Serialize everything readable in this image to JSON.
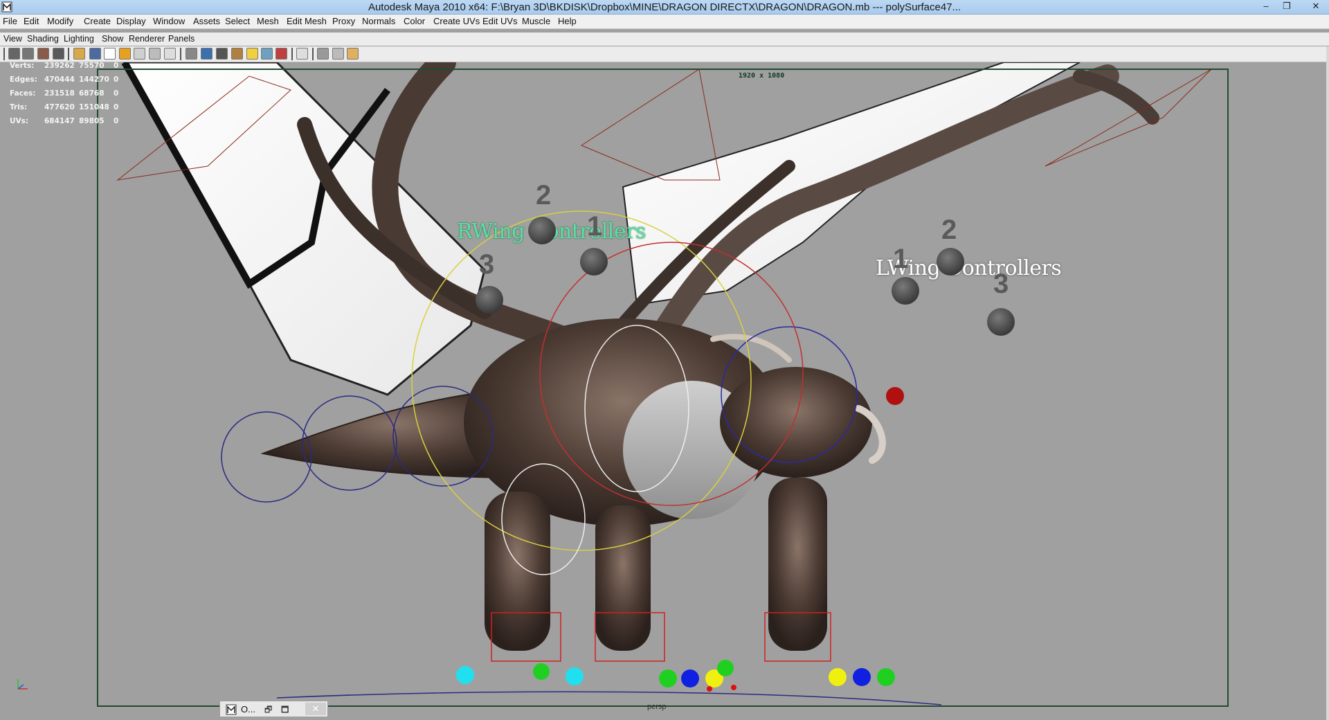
{
  "window": {
    "title": "Autodesk Maya 2010 x64: F:\\Bryan 3D\\BKDISK\\Dropbox\\MINE\\DRAGON DIRECTX\\DRAGON\\DRAGON.mb   ---   polySurface47...",
    "minimize": "–",
    "maximize": "❐",
    "close": "✕"
  },
  "menubar": [
    "File",
    "Edit",
    "Modify",
    "Create",
    "Display",
    "Window",
    "Assets",
    "Select",
    "Mesh",
    "Edit Mesh",
    "Proxy",
    "Normals",
    "Color",
    "Create UVs",
    "Edit UVs",
    "Muscle",
    "Help"
  ],
  "panel_menu": [
    "View",
    "Shading",
    "Lighting",
    "Show",
    "Renderer",
    "Panels"
  ],
  "hud": {
    "rows": [
      {
        "label": "Verts:",
        "a": "239262",
        "b": "75570",
        "c": "0"
      },
      {
        "label": "Edges:",
        "a": "470444",
        "b": "144270",
        "c": "0"
      },
      {
        "label": "Faces:",
        "a": "231518",
        "b": "68768",
        "c": "0"
      },
      {
        "label": "Tris:",
        "a": "477620",
        "b": "151048",
        "c": "0"
      },
      {
        "label": "UVs:",
        "a": "684147",
        "b": "89805",
        "c": "0"
      }
    ]
  },
  "viewport": {
    "resolution": "1920 x 1080",
    "camera": "persp",
    "rwing_label": "RWing Controllers",
    "lwing_label": "LWing Controllers",
    "numbers": [
      "2",
      "1",
      "3",
      "2",
      "1",
      "3"
    ]
  },
  "minimized_panel": {
    "label": "O...",
    "restore": "🗗",
    "maximize": "🗖",
    "close": "✕"
  },
  "colors": {
    "titlebar": "#b5d3f2",
    "viewport_bg": "#a0a0a0",
    "resgate": "#1f4a30",
    "rwing": "#5ee0a0"
  }
}
